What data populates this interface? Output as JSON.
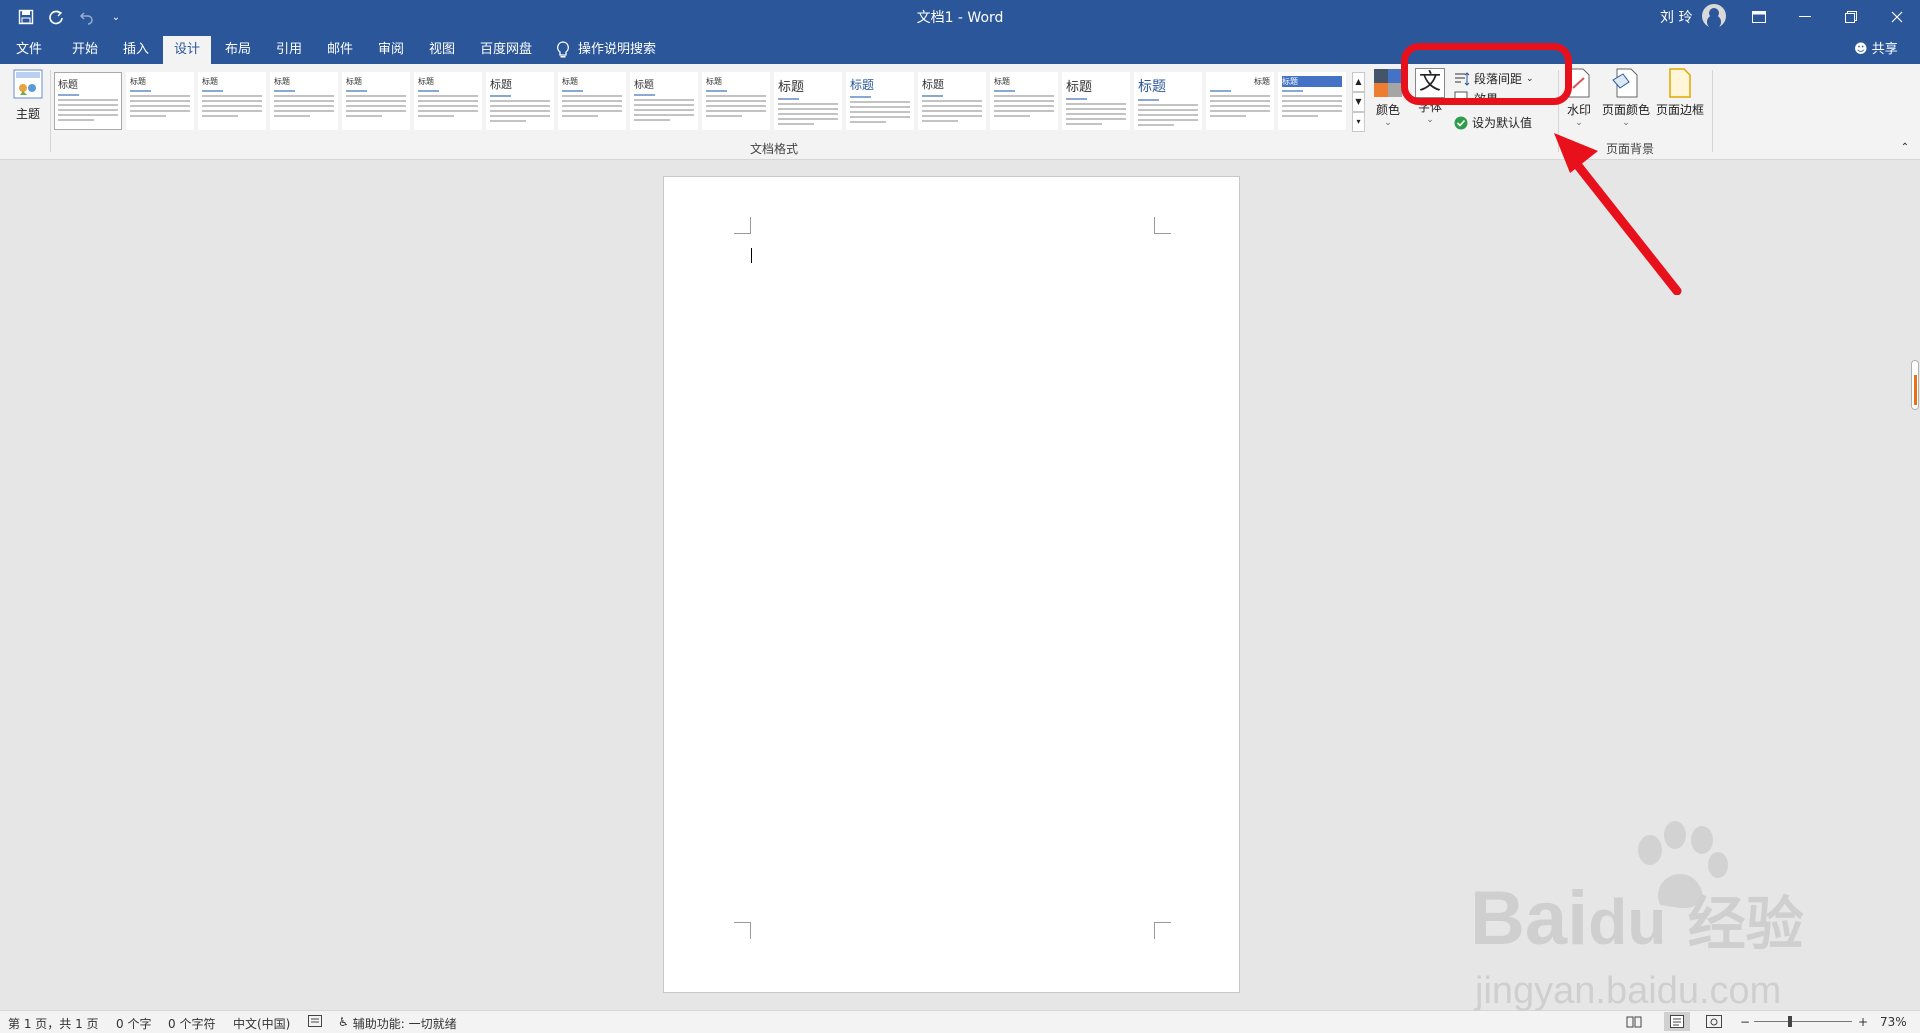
{
  "title_bar": {
    "doc_title": "文档1 - Word",
    "user": "刘 玲"
  },
  "tabs": [
    {
      "label": "文件",
      "active": false
    },
    {
      "label": "开始",
      "active": false
    },
    {
      "label": "插入",
      "active": false
    },
    {
      "label": "设计",
      "active": true
    },
    {
      "label": "布局",
      "active": false
    },
    {
      "label": "引用",
      "active": false
    },
    {
      "label": "邮件",
      "active": false
    },
    {
      "label": "审阅",
      "active": false
    },
    {
      "label": "视图",
      "active": false
    },
    {
      "label": "百度网盘",
      "active": false
    }
  ],
  "tell_me": "操作说明搜索",
  "share": "共享",
  "ribbon": {
    "theme_label": "主题",
    "gallery_label": "文档格式",
    "thumbnail_titles": [
      "标题",
      "标题",
      "标题",
      "标题",
      "标题",
      "标题",
      "标题",
      "标题",
      "标题",
      "标题",
      "标题",
      "标题",
      "标题",
      "标题",
      "标题",
      "标题",
      "标题",
      "标题"
    ],
    "colors_label": "颜色",
    "fonts_label": "字体",
    "paragraph_spacing_label": "段落间距",
    "effects_label": "效果",
    "set_default_label": "设为默认值",
    "watermark_label": "水印",
    "page_color_label": "页面颜色",
    "page_border_label": "页面边框",
    "page_background_label": "页面背景"
  },
  "status_bar": {
    "page": "第 1 页，共 1 页",
    "words": "0 个字",
    "chars": "0 个字符",
    "language": "中文(中国)",
    "accessibility": "辅助功能: 一切就绪",
    "zoom": "73%"
  },
  "watermark": {
    "brand": "Bai",
    "brand2": "du",
    "cn": "经验",
    "url": "jingyan.baidu.com"
  },
  "colors": {
    "titlebar": "#2b579a",
    "annotation": "#e8101a"
  }
}
